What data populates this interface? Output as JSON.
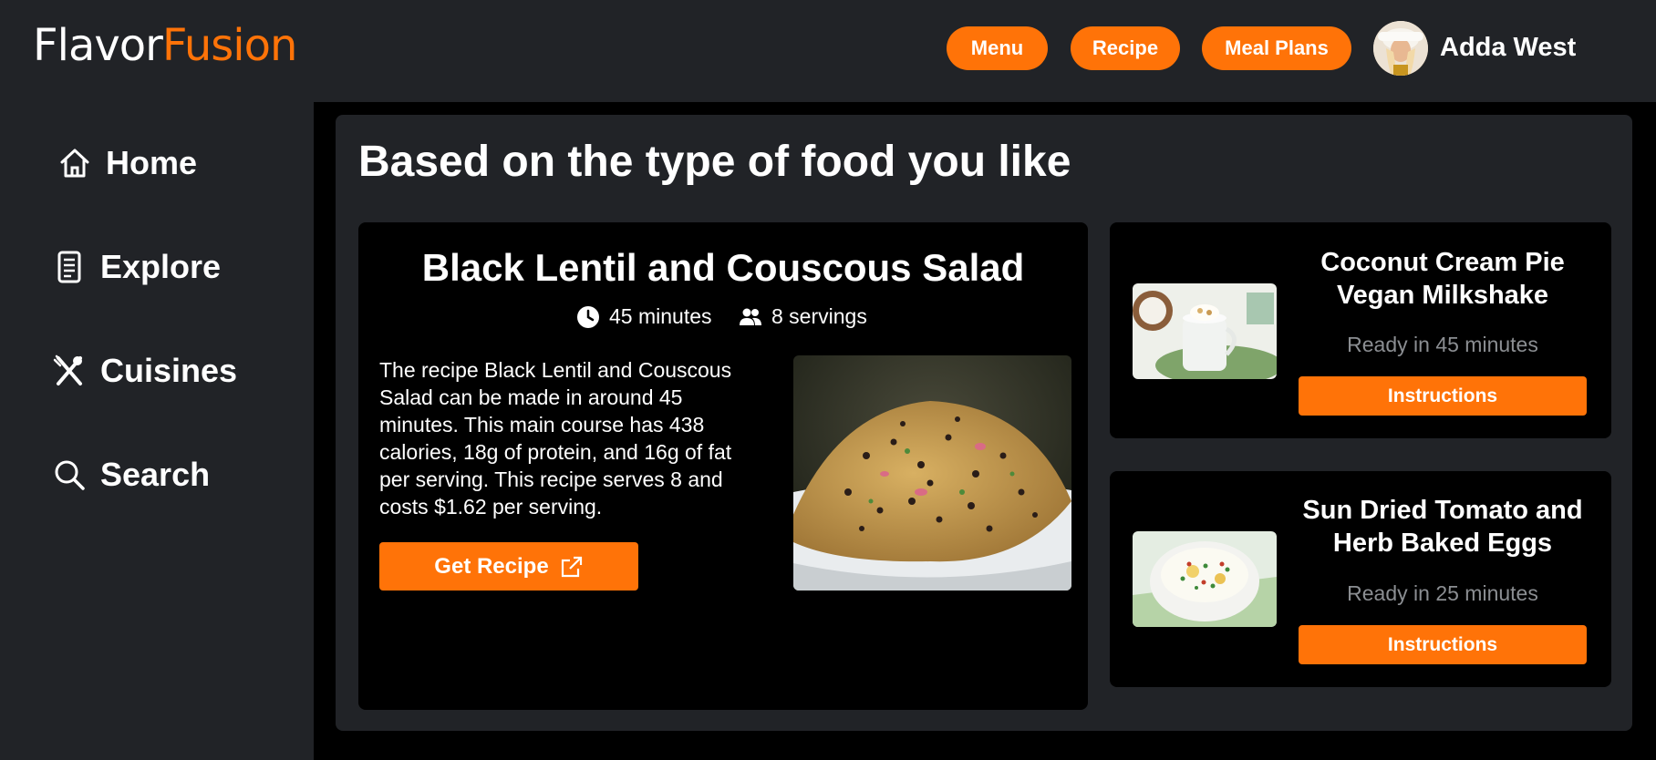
{
  "brand": {
    "part1": "Flavor",
    "part2": "Fusion",
    "accent": "#ff7308"
  },
  "header": {
    "nav": [
      {
        "label": "Menu"
      },
      {
        "label": "Recipe"
      },
      {
        "label": "Meal Plans"
      }
    ],
    "user": {
      "name": "Adda West",
      "avatar_icon": "user-avatar"
    }
  },
  "sidebar": {
    "items": [
      {
        "label": "Home",
        "icon": "home-icon"
      },
      {
        "label": "Explore",
        "icon": "document-icon"
      },
      {
        "label": "Cuisines",
        "icon": "utensils-icon"
      },
      {
        "label": "Search",
        "icon": "search-icon"
      }
    ]
  },
  "main": {
    "title": "Based on the type of food you like",
    "featured": {
      "title": "Black Lentil and Couscous Salad",
      "time": "45 minutes",
      "servings": "8 servings",
      "description": "The recipe Black Lentil and Couscous Salad can be made in around 45 minutes. This main course has 438 calories, 18g of protein, and 16g of fat per serving. This recipe serves 8 and costs $1.62 per serving.",
      "button_label": "Get Recipe"
    },
    "suggestions": [
      {
        "title": "Coconut Cream Pie Vegan Milkshake",
        "ready": "Ready in 45 minutes",
        "button_label": "Instructions"
      },
      {
        "title": "Sun Dried Tomato and Herb Baked Eggs",
        "ready": "Ready in 25 minutes",
        "button_label": "Instructions"
      }
    ]
  }
}
